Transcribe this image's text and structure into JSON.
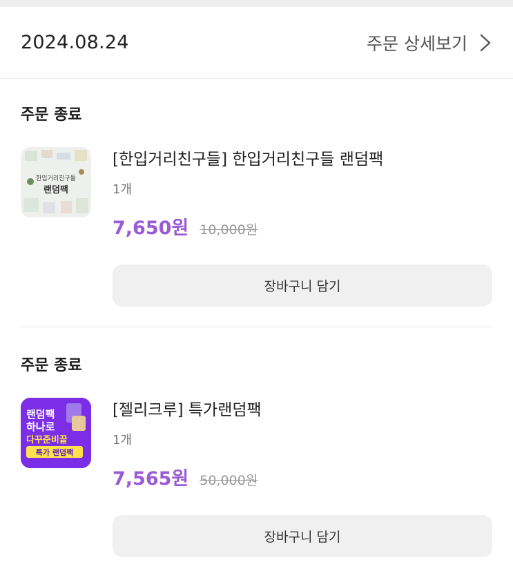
{
  "order": {
    "date": "2024.08.24",
    "detail_label": "주문 상세보기"
  },
  "items": [
    {
      "status": "주문 종료",
      "name": "[한입거리친구들] 한입거리친구들 랜덤팩",
      "quantity": "1개",
      "price": "7,650원",
      "original_price": "10,000원",
      "thumb_text": [
        "한입거리친구들",
        "랜덤팩"
      ],
      "cart_label": "장바구니 담기"
    },
    {
      "status": "주문 종료",
      "name": "[젤리크루] 특가랜덤팩",
      "quantity": "1개",
      "price": "7,565원",
      "original_price": "50,000원",
      "thumb_text": [
        "랜덤팩",
        "하나로",
        "다꾸준비끝",
        "특가 랜덤팩"
      ],
      "cart_label": "장바구니 담기"
    }
  ],
  "colors": {
    "price": "#9a5bd6",
    "thumb2_bg": "#7b2ee6",
    "button_bg": "#f0f0f0"
  }
}
